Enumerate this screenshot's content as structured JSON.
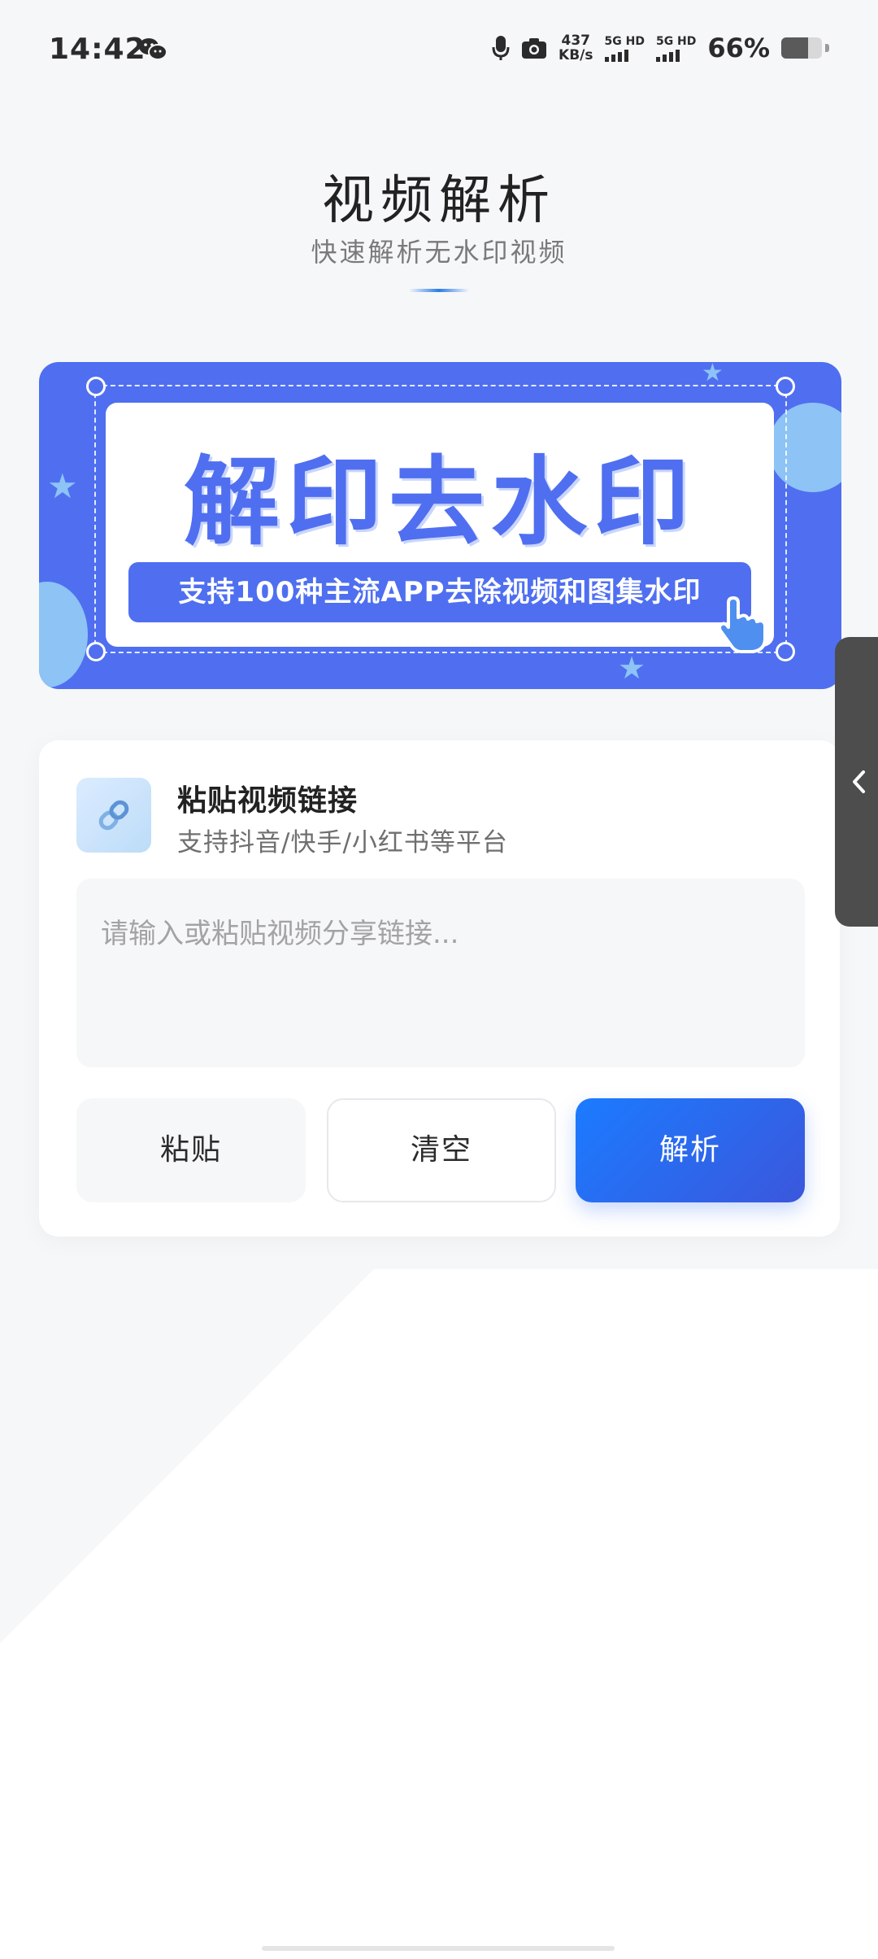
{
  "status_bar": {
    "time": "14:42",
    "net_speed_value": "437",
    "net_speed_unit": "KB/s",
    "sim1_label": "5G HD",
    "sim2_label": "5G HD",
    "battery_percent": "66%",
    "battery_level": 0.66
  },
  "header": {
    "title": "视频解析",
    "subtitle": "快速解析无水印视频"
  },
  "banner": {
    "headline": "解印去水印",
    "tagline": "支持100种主流APP去除视频和图集水印",
    "colors": {
      "primary": "#4f6ff0",
      "accent": "#8dc3f5"
    }
  },
  "input_card": {
    "title": "粘贴视频链接",
    "subtitle": "支持抖音/快手/小红书等平台",
    "input_value": "",
    "input_placeholder": "请输入或粘贴视频分享链接...",
    "buttons": {
      "paste": "粘贴",
      "clear": "清空",
      "parse": "解析"
    }
  },
  "icons": {
    "link": "link-icon",
    "side_tab": "chevron-left-icon",
    "banner_hand": "pointer-hand-icon"
  }
}
